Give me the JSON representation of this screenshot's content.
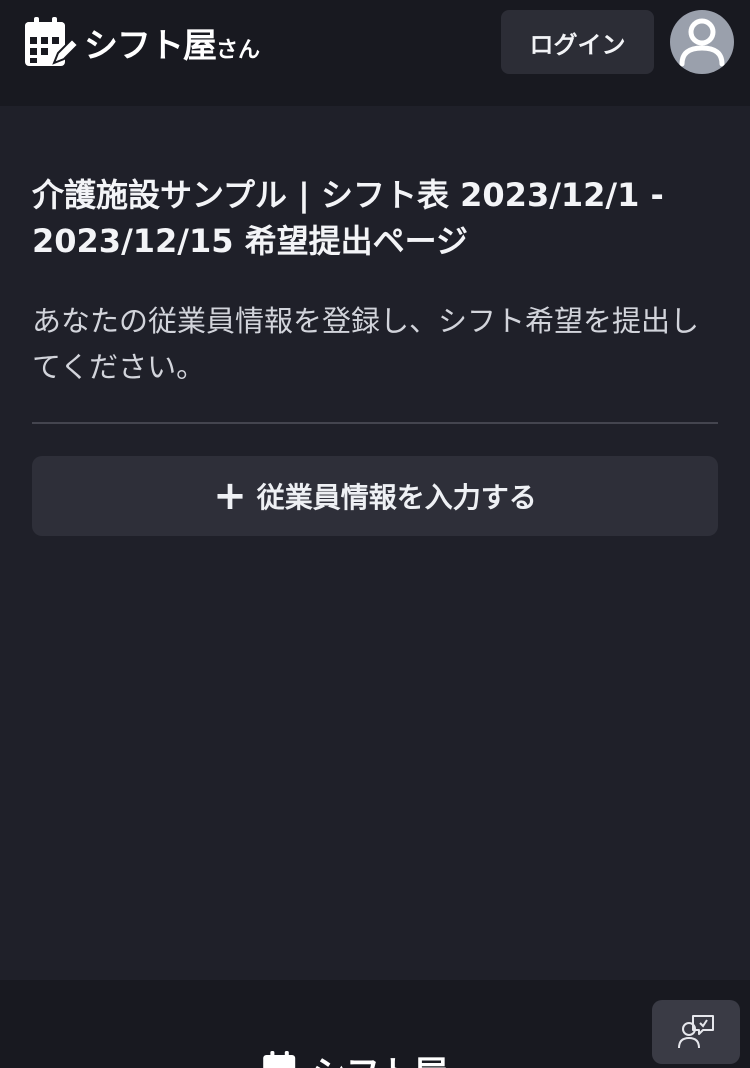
{
  "header": {
    "logo_text": "シフト屋",
    "logo_suffix": "さん",
    "login_label": "ログイン",
    "icons": {
      "logo": "calendar-edit-icon",
      "avatar": "user-avatar-icon"
    }
  },
  "main": {
    "title": "介護施設サンプル | シフト表 2023/12/1 - 2023/12/15 希望提出ページ",
    "description": "あなたの従業員情報を登録し、シフト希望を提出してください。",
    "add_button_label": "従業員情報を入力する",
    "add_button_icon": "plus-icon"
  },
  "footer": {
    "logo_text": "シフト屋",
    "feedback_icon": "feedback-chat-icon"
  },
  "colors": {
    "background": "#1f2029",
    "header": "#181920",
    "button": "#2e2f39",
    "avatar": "#9aa0ac"
  }
}
